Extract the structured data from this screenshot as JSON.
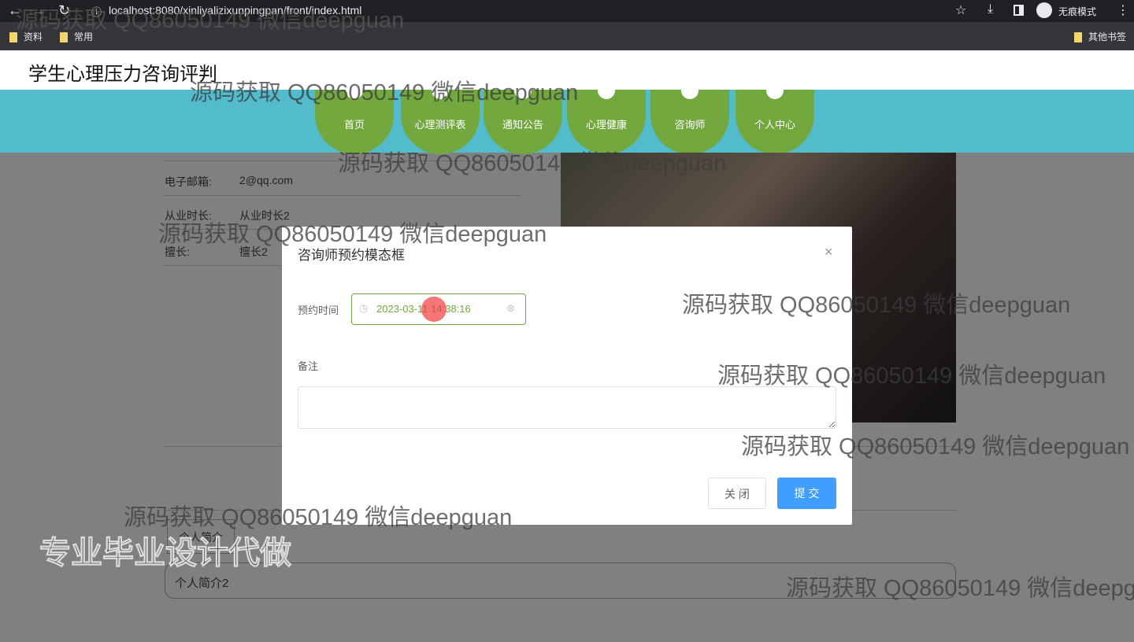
{
  "browser": {
    "url": "localhost:8080/xinliyalizixunpingpan/front/index.html",
    "bookmarks": [
      "资料",
      "常用"
    ],
    "other_bookmarks": "其他书签",
    "incognito": "无痕模式"
  },
  "site": {
    "title": "学生心理压力咨询评判",
    "nav": [
      "首页",
      "心理测评表",
      "通知公告",
      "心理健康",
      "咨询师",
      "个人中心"
    ]
  },
  "detail": {
    "rows": [
      {
        "label": "电子邮箱:",
        "value": "2@qq.com"
      },
      {
        "label": "从业时长:",
        "value": "从业时长2"
      },
      {
        "label": "擅长:",
        "value": "擅长2"
      }
    ],
    "tab": "个人简介",
    "intro": "个人简介2"
  },
  "modal": {
    "title": "咨询师预约模态框",
    "time_label": "预约时间",
    "time_value": "2023-03-11 14:38:16",
    "remark_label": "备注",
    "remark_value": "",
    "close": "关 闭",
    "submit": "提 交"
  },
  "watermarks": {
    "text": "源码获取 QQ86050149 微信deepguan",
    "banner": "专业毕业设计代做"
  },
  "colors": {
    "nav_bg": "#52bccc",
    "nav_item": "#72a83e",
    "primary": "#409eff"
  }
}
